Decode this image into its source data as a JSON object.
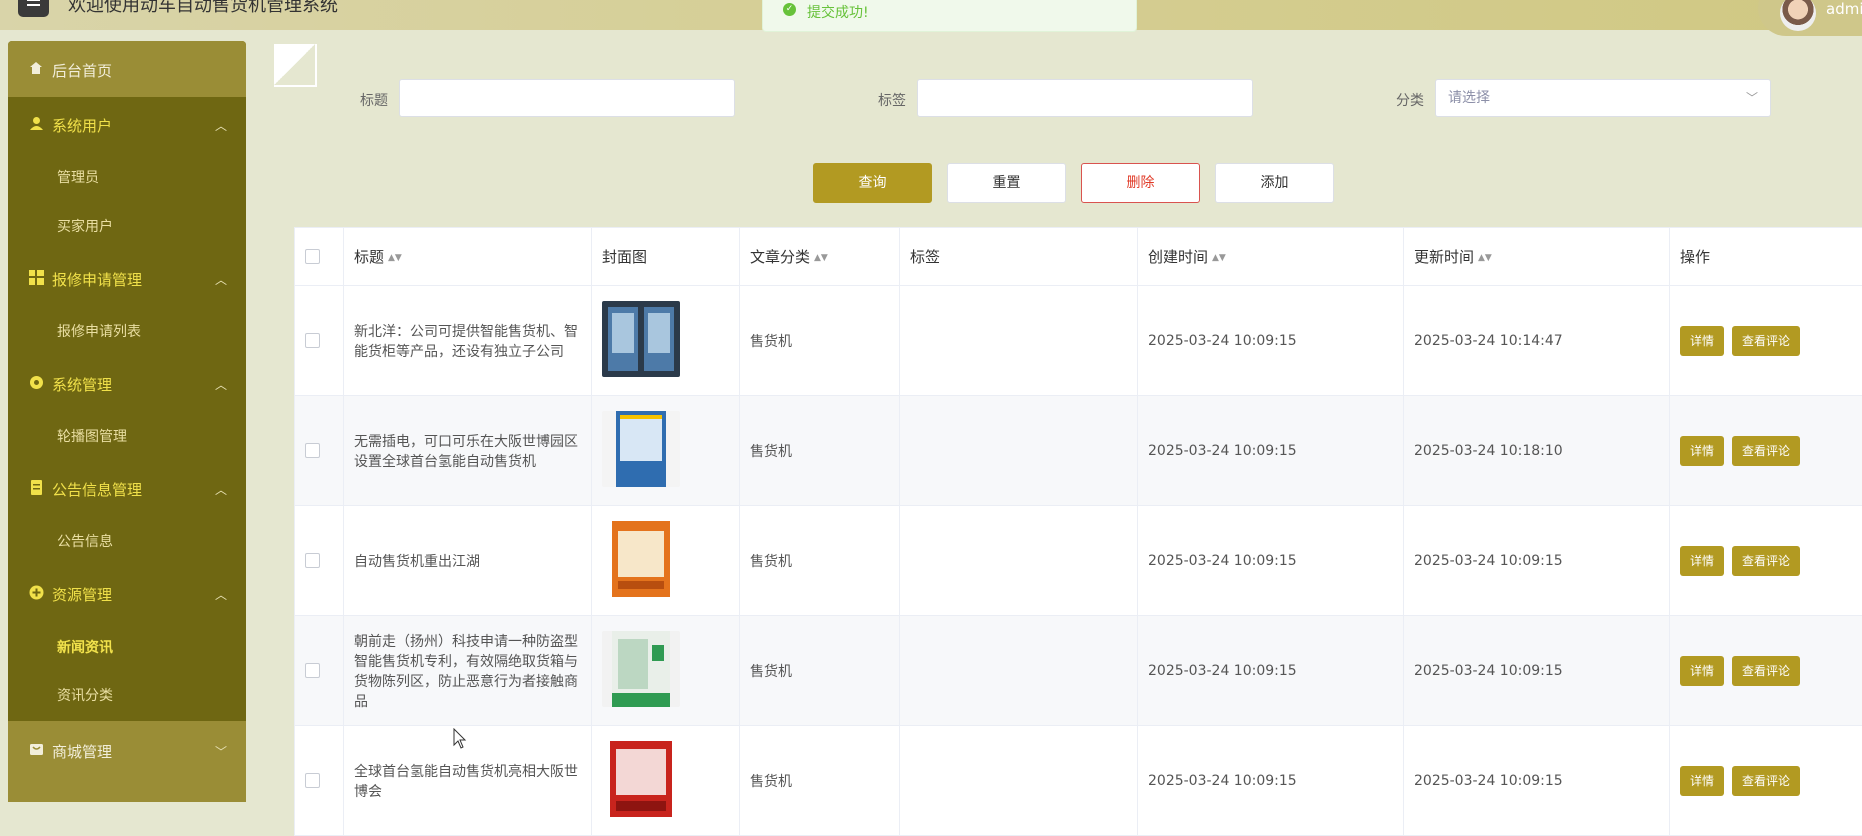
{
  "header": {
    "title": "欢迎使用动车自动售货机管理系统",
    "user_name": "admin"
  },
  "toast": {
    "message": "提交成功!"
  },
  "sidebar": {
    "home": "后台首页",
    "groups": [
      {
        "label": "系统用户",
        "children": [
          "管理员",
          "买家用户"
        ]
      },
      {
        "label": "报修申请管理",
        "children": [
          "报修申请列表"
        ]
      },
      {
        "label": "系统管理",
        "children": [
          "轮播图管理"
        ]
      },
      {
        "label": "公告信息管理",
        "children": [
          "公告信息"
        ]
      },
      {
        "label": "资源管理",
        "children": [
          "新闻资讯",
          "资讯分类"
        ]
      },
      {
        "label": "商城管理",
        "children": []
      }
    ],
    "active_item": "新闻资讯"
  },
  "filters": {
    "title_label": "标题",
    "tag_label": "标签",
    "category_label": "分类",
    "category_placeholder": "请选择"
  },
  "buttons": {
    "search": "查询",
    "reset": "重置",
    "delete": "删除",
    "add": "添加"
  },
  "table": {
    "columns": [
      "标题",
      "封面图",
      "文章分类",
      "标签",
      "创建时间",
      "更新时间",
      "操作"
    ],
    "rows": [
      {
        "title": "新北洋：公司可提供智能售货机、智能货柜等产品，还设有独立子公司",
        "category": "售货机",
        "tag": "",
        "created": "2025-03-24 10:09:15",
        "updated": "2025-03-24 10:14:47"
      },
      {
        "title": "无需插电，可口可乐在大阪世博园区设置全球首台氢能自动售货机",
        "category": "售货机",
        "tag": "",
        "created": "2025-03-24 10:09:15",
        "updated": "2025-03-24 10:18:10"
      },
      {
        "title": "自动售货机重出江湖",
        "category": "售货机",
        "tag": "",
        "created": "2025-03-24 10:09:15",
        "updated": "2025-03-24 10:09:15"
      },
      {
        "title": "朝前走（扬州）科技申请一种防盗型智能售货机专利，有效隔绝取货箱与货物陈列区，防止恶意行为者接触商品",
        "category": "售货机",
        "tag": "",
        "created": "2025-03-24 10:09:15",
        "updated": "2025-03-24 10:09:15"
      },
      {
        "title": "全球首台氢能自动售货机亮相大阪世博会",
        "category": "售货机",
        "tag": "",
        "created": "2025-03-24 10:09:15",
        "updated": "2025-03-24 10:09:15"
      }
    ],
    "row_actions": {
      "detail": "详情",
      "comments": "查看评论"
    }
  },
  "colors": {
    "accent": "#b29a22",
    "sidebar_bg": "#6f6712",
    "sidebar_text": "#f1e14a",
    "danger": "#e03b28"
  }
}
